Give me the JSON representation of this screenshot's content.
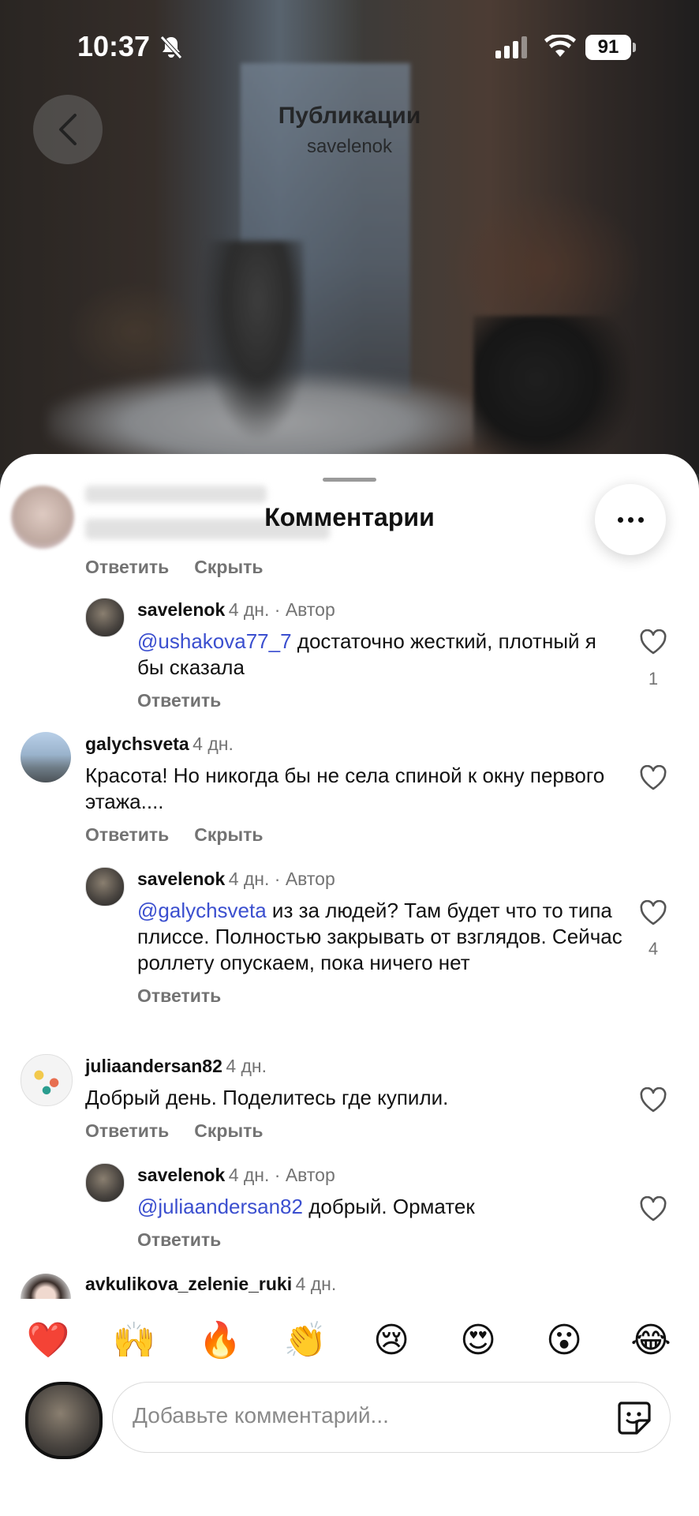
{
  "status_bar": {
    "time": "10:37",
    "battery": "91",
    "icons": [
      "bell-slash-icon",
      "signal-icon",
      "wifi-icon",
      "battery-icon"
    ]
  },
  "header": {
    "title": "Публикации",
    "subtitle": "savelenok",
    "back_icon": "chevron-left-icon"
  },
  "sheet": {
    "title": "Комментарии",
    "more_icon": "more-horizontal-icon"
  },
  "comments": [
    {
      "id": "c1-actions",
      "reply": "Ответить",
      "hide": "Скрыть"
    },
    {
      "id": "r1",
      "username": "savelenok",
      "meta": "4 дн. · Автор",
      "mention": "@ushakova77_7",
      "text": " достаточно жесткий, плотный я бы сказала",
      "reply": "Ответить",
      "likes": "1"
    },
    {
      "id": "c2",
      "username": "galychsveta",
      "meta": "4 дн.",
      "text": "Красота! Но никогда бы не села спиной к окну первого этажа....",
      "reply": "Ответить",
      "hide": "Скрыть"
    },
    {
      "id": "r2",
      "username": "savelenok",
      "meta": "4 дн. · Автор",
      "mention": "@galychsveta",
      "text": " из за людей? Там будет что то типа плиссе. Полностью закрывать от взглядов. Сейчас роллету опускаем, пока ничего нет",
      "reply": "Ответить",
      "likes": "4"
    },
    {
      "id": "c3",
      "username": "juliaandersan82",
      "meta": "4 дн.",
      "text": "Добрый день. Поделитесь где купили.",
      "reply": "Ответить",
      "hide": "Скрыть"
    },
    {
      "id": "r3",
      "username": "savelenok",
      "meta": "4 дн. · Автор",
      "mention": "@juliaandersan82",
      "text": " добрый. Орматек",
      "reply": "Ответить"
    },
    {
      "id": "c4",
      "username": "avkulikova_zelenie_ruki",
      "meta": "4 дн."
    }
  ],
  "emoji_bar": [
    "❤️",
    "🙌",
    "🔥",
    "👏",
    "😢",
    "😍",
    "😮",
    "😂"
  ],
  "input": {
    "placeholder": "Добавьте комментарий...",
    "sticker_icon": "sticker-icon"
  },
  "colors": {
    "mention": "#3b4fcf",
    "muted": "#737373",
    "text": "#111111"
  }
}
